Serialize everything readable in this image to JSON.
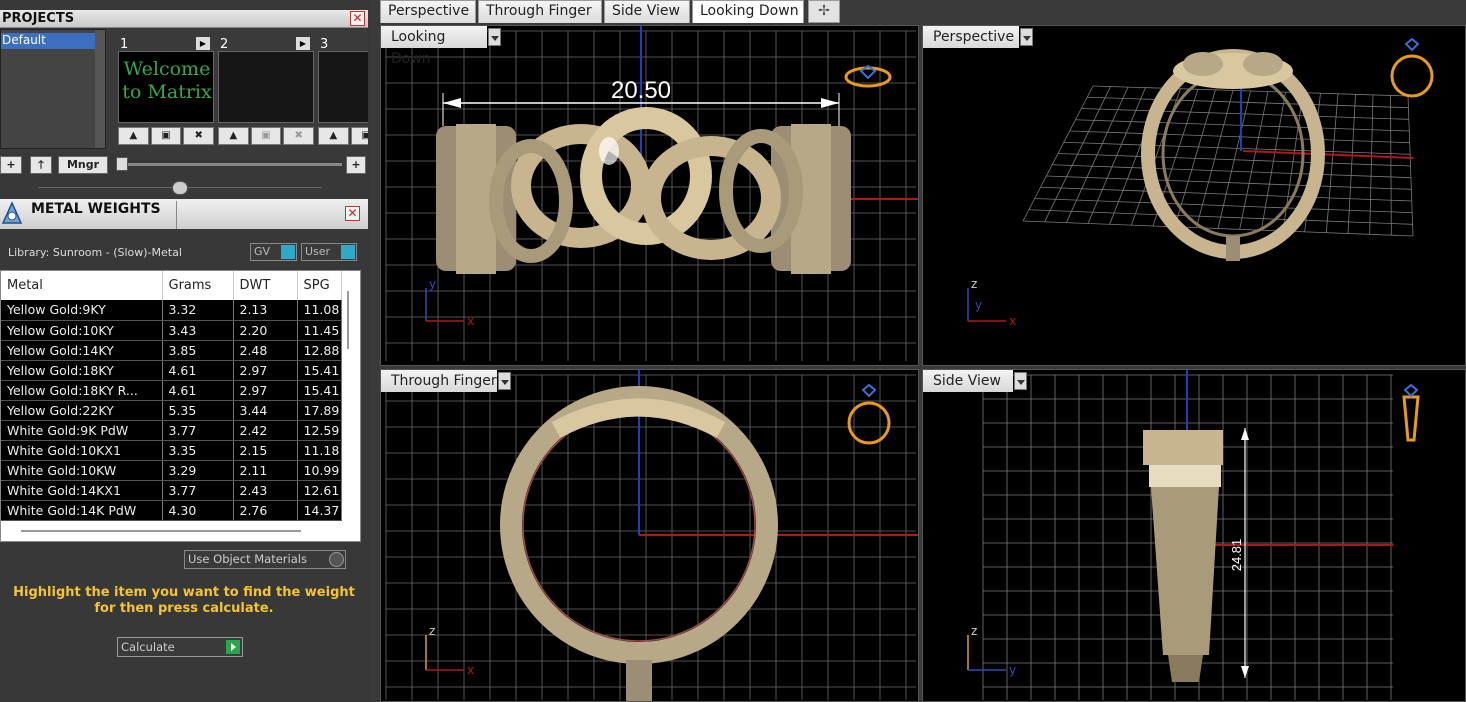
{
  "projects": {
    "title": "PROJECTS",
    "close": "✕",
    "list_item": "Default",
    "slots": [
      {
        "num": "1",
        "thumb_text": "Welcome to Matrix"
      },
      {
        "num": "2"
      },
      {
        "num": "3"
      }
    ],
    "buttons": {
      "add": "+",
      "up": "🡑",
      "manager": "Mngr",
      "plus_right": "+"
    }
  },
  "metal_weights": {
    "title": "METAL WEIGHTS",
    "close": "✕",
    "library": "Library: Sunroom - (Slow)-Metal",
    "toggle_gv": "GV",
    "toggle_user": "User",
    "columns": [
      "Metal",
      "Grams",
      "DWT",
      "SPG"
    ],
    "rows": [
      [
        "Yellow Gold:9KY",
        "3.32",
        "2.13",
        "11.08"
      ],
      [
        "Yellow Gold:10KY",
        "3.43",
        "2.20",
        "11.45"
      ],
      [
        "Yellow Gold:14KY",
        "3.85",
        "2.48",
        "12.88"
      ],
      [
        "Yellow Gold:18KY",
        "4.61",
        "2.97",
        "15.41"
      ],
      [
        "Yellow Gold:18KY R...",
        "4.61",
        "2.97",
        "15.41"
      ],
      [
        "Yellow Gold:22KY",
        "5.35",
        "3.44",
        "17.89"
      ],
      [
        "White Gold:9K PdW",
        "3.77",
        "2.42",
        "12.59"
      ],
      [
        "White Gold:10KX1",
        "3.35",
        "2.15",
        "11.18"
      ],
      [
        "White Gold:10KW",
        "3.29",
        "2.11",
        "10.99"
      ],
      [
        "White Gold:14KX1",
        "3.77",
        "2.43",
        "12.61"
      ],
      [
        "White Gold:14K PdW",
        "4.30",
        "2.76",
        "14.37"
      ]
    ],
    "use_object_materials": "Use Object Materials",
    "hint": "Highlight the item you want to find the weight for then press calculate.",
    "calculate": "Calculate"
  },
  "tabs": [
    "Perspective",
    "Through Finger",
    "Side View",
    "Looking Down"
  ],
  "active_tab": "Looking Down",
  "add_tab": "✢",
  "viewports": {
    "looking_down": {
      "label": "Looking Down",
      "dimension": "20.50",
      "axis_y": "y",
      "axis_x": "x"
    },
    "perspective": {
      "label": "Perspective",
      "axis_z": "z",
      "axis_y": "y",
      "axis_x": "x"
    },
    "through_finger": {
      "label": "Through Finger",
      "axis_z": "z",
      "axis_x": "x"
    },
    "side_view": {
      "label": "Side View",
      "dimension": "24.81",
      "axis_z": "z",
      "axis_y": "y"
    }
  },
  "colors": {
    "accent_blue": "#3c6fbf",
    "hint_yellow": "#f6c42c",
    "gold": "#c8b48e",
    "axis_red": "#b01818",
    "axis_blue": "#1f3fbf"
  }
}
